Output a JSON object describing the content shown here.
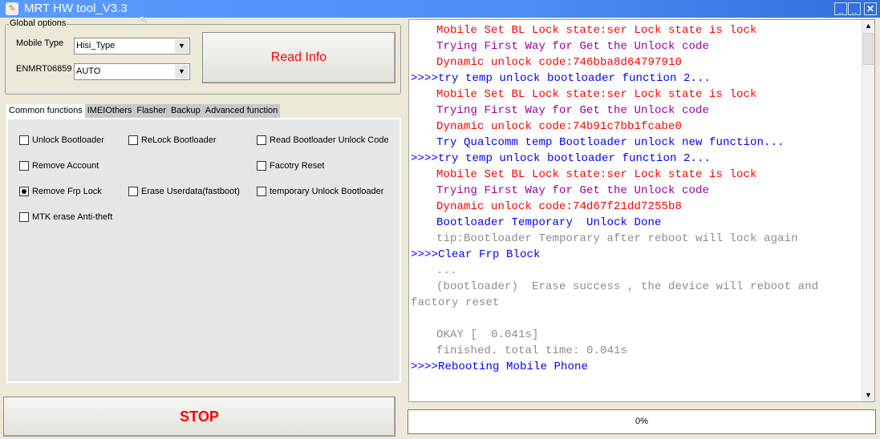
{
  "window": {
    "title": "MRT HW tool_V3.3",
    "minimize": "_",
    "maximize": "_",
    "close": "✕"
  },
  "global_options": {
    "label": "Global options",
    "mobile_type_label": "Mobile Type",
    "mobile_type_value": "Hisi_Type",
    "enmrt_label": "ENMRT06859",
    "enmrt_value": "AUTO",
    "read_info": "Read Info"
  },
  "tabs": [
    "Common functions",
    "IMEIOthers",
    "Flasher",
    "Backup",
    "Advanced function"
  ],
  "functions": [
    {
      "label": "Unlock Bootloader",
      "checked": false
    },
    {
      "label": "ReLock Bootloader",
      "checked": false
    },
    {
      "label": "Read Bootloader Unlock Code",
      "checked": false
    },
    {
      "label": "Remove Account",
      "checked": false
    },
    {
      "label": "Facotry Reset",
      "checked": false
    },
    {
      "label": "Remove Frp Lock",
      "checked": true
    },
    {
      "label": "Erase Userdata(fastboot)",
      "checked": false
    },
    {
      "label": "temporary Unlock Bootloader",
      "checked": false
    },
    {
      "label": "MTK erase Anti-theft",
      "checked": false
    }
  ],
  "stop": "STOP",
  "progress": {
    "text": "0%",
    "value": 0
  },
  "colors": {
    "red": "#ff0000",
    "purple": "#9900aa",
    "blue": "#0000ff",
    "gray": "#8c8c8c"
  },
  "log": [
    {
      "text": "Mobile Set BL Lock state:ser Lock state is lock",
      "color": "red"
    },
    {
      "text": "Trying First Way for Get the Unlock code",
      "color": "purple"
    },
    {
      "text": "Dynamic unlock code:746bba8d64797910",
      "color": "red"
    },
    {
      "text": ">>>>try temp unlock bootloader function 2...",
      "color": "blue",
      "cmd": true
    },
    {
      "text": "Mobile Set BL Lock state:ser Lock state is lock",
      "color": "red"
    },
    {
      "text": "Trying First Way for Get the Unlock code",
      "color": "purple"
    },
    {
      "text": "Dynamic unlock code:74b91c7bb1fcabe0",
      "color": "red"
    },
    {
      "text": "Try Qualcomm temp Bootloader unlock new function...",
      "color": "blue"
    },
    {
      "text": ">>>>try temp unlock bootloader function 2...",
      "color": "blue",
      "cmd": true
    },
    {
      "text": "Mobile Set BL Lock state:ser Lock state is lock",
      "color": "red"
    },
    {
      "text": "Trying First Way for Get the Unlock code",
      "color": "purple"
    },
    {
      "text": "Dynamic unlock code:74d67f21dd7255b8",
      "color": "red"
    },
    {
      "text": "Bootloader Temporary  Unlock Done",
      "color": "blue"
    },
    {
      "text": "tip:Bootloader Temporary after reboot will lock again",
      "color": "gray"
    },
    {
      "text": ">>>>Clear Frp Block",
      "color": "blue",
      "cmd": true
    },
    {
      "text": "...",
      "color": "gray"
    },
    {
      "text": "(bootloader)  Erase success , the device will reboot and factory reset",
      "color": "gray",
      "wrap": true
    },
    {
      "text": " ",
      "color": "gray"
    },
    {
      "text": "OKAY [  0.041s]",
      "color": "gray"
    },
    {
      "text": "finished. total time: 0.041s",
      "color": "gray"
    },
    {
      "text": ">>>>Rebooting Mobile Phone",
      "color": "blue",
      "cmd": true
    }
  ]
}
